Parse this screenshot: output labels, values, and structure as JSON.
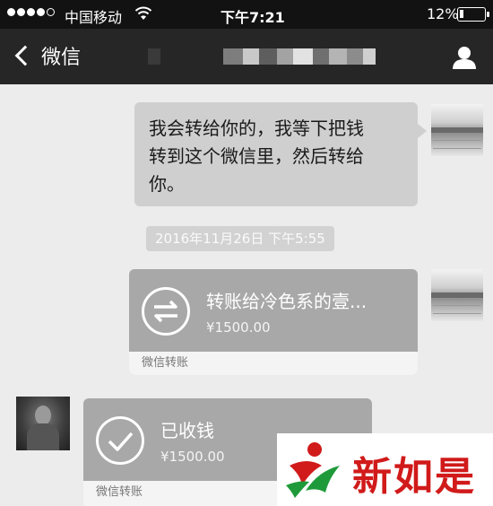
{
  "status_bar": {
    "carrier": "中国移动",
    "time": "下午7:21",
    "battery": "12%"
  },
  "nav": {
    "back_label": "微信"
  },
  "messages": {
    "outgoing_text": [
      "我会转给你的，我等下把钱",
      "转到这个微信里，然后转给",
      "你。"
    ],
    "timestamp": "2016年11月26日  下午5:55",
    "transfer_out": {
      "label": "转账给冷色系的壹...",
      "amount": "¥1500.00",
      "footer": "微信转账"
    },
    "transfer_in": {
      "label": "已收钱",
      "amount": "¥1500.00",
      "footer": "微信转账"
    }
  },
  "watermark": {
    "text": "新如是"
  },
  "colors": {
    "status_bg": "#121212",
    "nav_bg": "#262626",
    "chat_bg": "#ececec",
    "transfer_bg": "#a8a8a8",
    "watermark_red": "#d11a1a"
  }
}
